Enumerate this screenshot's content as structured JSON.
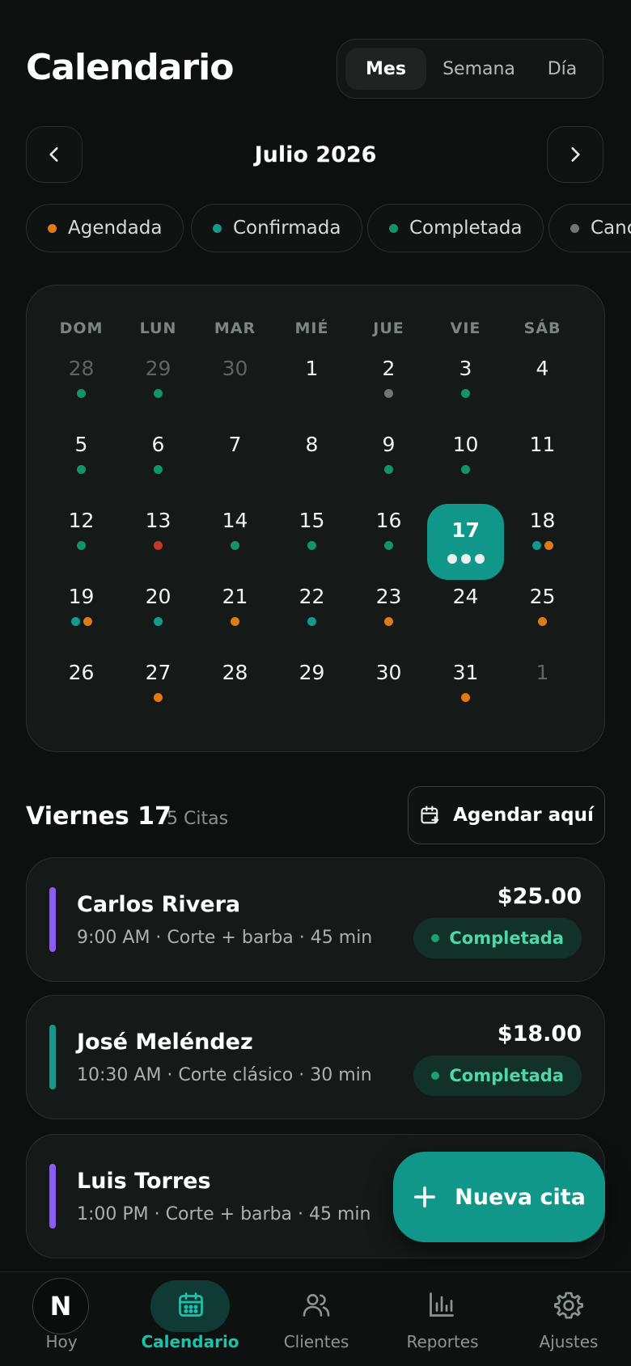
{
  "header": {
    "title": "Calendario"
  },
  "view_switch": {
    "options": [
      "Mes",
      "Semana",
      "Día"
    ],
    "active": "Mes"
  },
  "month_nav": {
    "label": "Julio 2026",
    "prev_icon": "chevron-left-icon",
    "next_icon": "chevron-right-icon"
  },
  "legend": [
    {
      "label": "Agendada",
      "color": "#e07b14"
    },
    {
      "label": "Confirmada",
      "color": "#14998c"
    },
    {
      "label": "Completada",
      "color": "#13936a"
    },
    {
      "label": "Canc",
      "color": "#6f7674"
    }
  ],
  "calendar": {
    "weekdays": [
      "DOM",
      "LUN",
      "MAR",
      "MIÉ",
      "JUE",
      "VIE",
      "SÁB"
    ],
    "weeks": [
      [
        {
          "d": "28",
          "m": true,
          "dots": [
            "#13936a"
          ]
        },
        {
          "d": "29",
          "m": true,
          "dots": [
            "#13936a"
          ]
        },
        {
          "d": "30",
          "m": true,
          "dots": []
        },
        {
          "d": "1",
          "dots": []
        },
        {
          "d": "2",
          "dots": [
            "#6f7674"
          ]
        },
        {
          "d": "3",
          "dots": [
            "#13936a"
          ]
        },
        {
          "d": "4",
          "dots": []
        }
      ],
      [
        {
          "d": "5",
          "dots": [
            "#13936a"
          ]
        },
        {
          "d": "6",
          "dots": [
            "#13936a"
          ]
        },
        {
          "d": "7",
          "dots": []
        },
        {
          "d": "8",
          "dots": []
        },
        {
          "d": "9",
          "dots": [
            "#13936a"
          ]
        },
        {
          "d": "10",
          "dots": [
            "#13936a"
          ]
        },
        {
          "d": "11",
          "dots": []
        }
      ],
      [
        {
          "d": "12",
          "dots": [
            "#13936a"
          ]
        },
        {
          "d": "13",
          "dots": [
            "#c0392b"
          ]
        },
        {
          "d": "14",
          "dots": [
            "#13936a"
          ]
        },
        {
          "d": "15",
          "dots": [
            "#13936a"
          ]
        },
        {
          "d": "16",
          "dots": [
            "#13936a"
          ]
        },
        {
          "d": "17",
          "sel": true,
          "dots": [
            "#fff",
            "#fff",
            "#fff"
          ]
        },
        {
          "d": "18",
          "dots": [
            "#14998c",
            "#e07b14"
          ]
        }
      ],
      [
        {
          "d": "19",
          "dots": [
            "#14998c",
            "#e07b14"
          ]
        },
        {
          "d": "20",
          "dots": [
            "#14998c"
          ]
        },
        {
          "d": "21",
          "dots": [
            "#e07b14"
          ]
        },
        {
          "d": "22",
          "dots": [
            "#14998c"
          ]
        },
        {
          "d": "23",
          "dots": [
            "#e07b14"
          ]
        },
        {
          "d": "24",
          "dots": []
        },
        {
          "d": "25",
          "dots": [
            "#e07b14"
          ]
        }
      ],
      [
        {
          "d": "26",
          "dots": []
        },
        {
          "d": "27",
          "dots": [
            "#e07b14"
          ]
        },
        {
          "d": "28",
          "dots": []
        },
        {
          "d": "29",
          "dots": []
        },
        {
          "d": "30",
          "dots": []
        },
        {
          "d": "31",
          "dots": [
            "#e07b14"
          ]
        },
        {
          "d": "1",
          "m": true,
          "dots": []
        }
      ]
    ]
  },
  "day_section": {
    "title": "Viernes 17",
    "count": "5 Citas",
    "add_label": "Agendar aquí"
  },
  "appointments": [
    {
      "name": "Carlos Rivera",
      "meta": "9:00 AM · Corte + barba · 45 min",
      "price": "$25.00",
      "status": "Completada",
      "bar_color": "#8b5cf6"
    },
    {
      "name": "José Meléndez",
      "meta": "10:30 AM · Corte clásico · 30 min",
      "price": "$18.00",
      "status": "Completada",
      "bar_color": "#14998c"
    },
    {
      "name": "Luis Torres",
      "meta": "1:00 PM · Corte + barba · 45 min",
      "price": "",
      "status": "",
      "bar_color": "#8b5cf6"
    }
  ],
  "fab": {
    "label": "Nueva cita",
    "icon": "plus-icon"
  },
  "bottom_nav": {
    "avatar_letter": "N",
    "items": [
      {
        "label": "Hoy",
        "icon": "avatar"
      },
      {
        "label": "Calendario",
        "icon": "calendar-icon",
        "active": true
      },
      {
        "label": "Clientes",
        "icon": "users-icon"
      },
      {
        "label": "Reportes",
        "icon": "bar-chart-icon"
      },
      {
        "label": "Ajustes",
        "icon": "gear-icon"
      }
    ]
  }
}
